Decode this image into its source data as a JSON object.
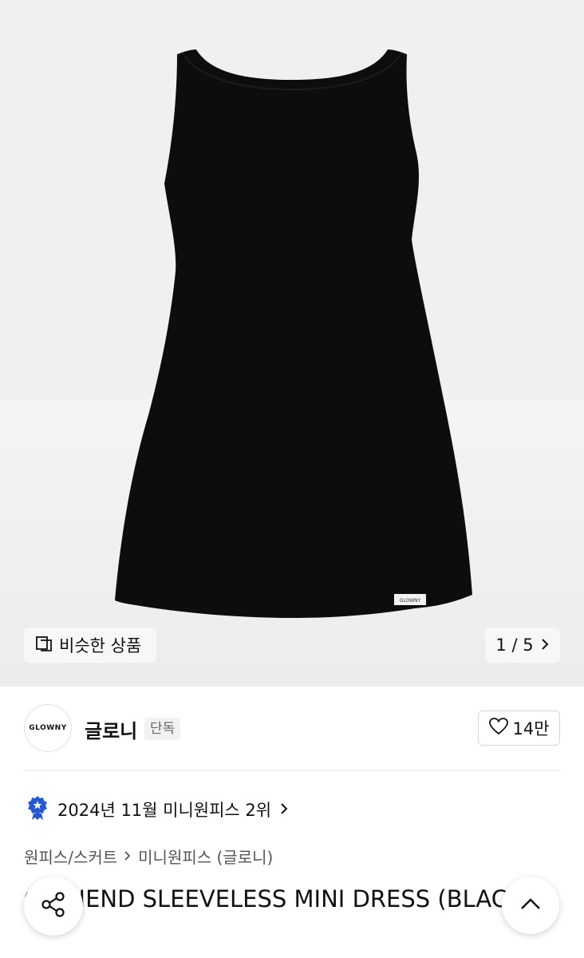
{
  "hero": {
    "similar_label": "비슷한 상품",
    "page_indicator": "1 / 5",
    "dress_label_tag": "GLOWNY"
  },
  "brand": {
    "logo_text": "GLOWNY",
    "name": "글로니",
    "tag": "단독",
    "likes": "14만"
  },
  "ranking": {
    "text": "2024년 11월 미니원피스 2위"
  },
  "breadcrumb": {
    "category": "원피스/스커트",
    "subcategory": "미니원피스 (글로니)"
  },
  "product": {
    "title": "G FRIEND SLEEVELESS MINI DRESS (BLACK)"
  },
  "colors": {
    "dress": "#0d0d0d",
    "badge": "#2457d6"
  }
}
